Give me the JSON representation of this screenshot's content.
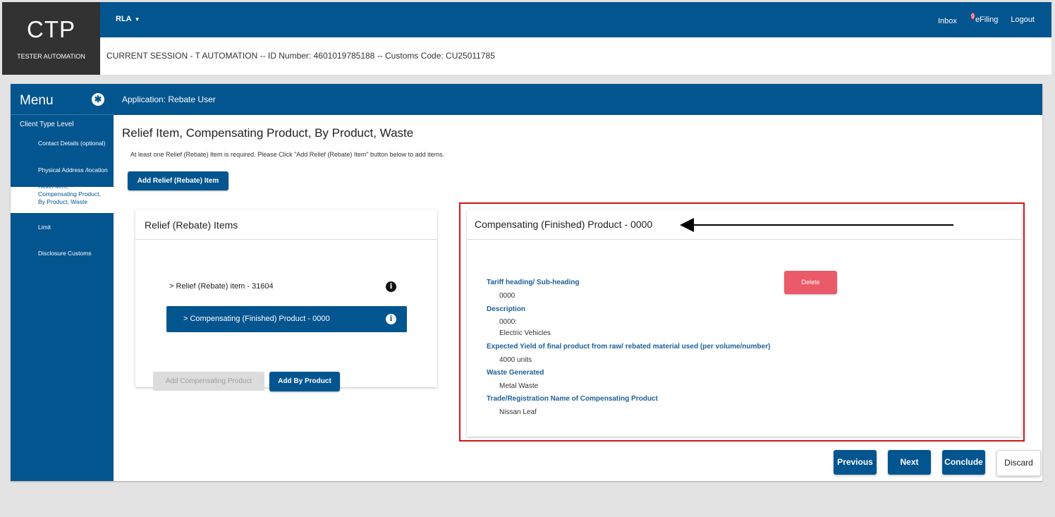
{
  "header": {
    "logo": "CTP",
    "user": "TESTER AUTOMATION",
    "app_menu": "RLA",
    "links": {
      "inbox": "Inbox",
      "inbox_count": "9",
      "efiling": "eFiling",
      "logout": "Logout"
    },
    "session": "CURRENT SESSION - T AUTOMATION -- ID Number: 4601019785188 -- Customs Code: CU25011785"
  },
  "sidebar": {
    "title": "Menu",
    "level": "Client Type Level",
    "items": [
      {
        "label": "Contact Details (optional)"
      },
      {
        "label": "Physical Address /location"
      },
      {
        "label": "Relief Item, Compensating Product, By Product, Waste"
      },
      {
        "label": "Limit"
      },
      {
        "label": "Disclosure Customs"
      }
    ]
  },
  "app_bar": {
    "title": "Application: Rebate User"
  },
  "page": {
    "title": "Relief Item, Compensating Product, By Product, Waste",
    "info": "At least one Relief (Rebate) Item is required. Please Click \"Add Relief (Rebate) Item\" button below to add items.",
    "add_relief_button": "Add Relief (Rebate) Item"
  },
  "relief_panel": {
    "title": "Relief (Rebate) Items",
    "tree": [
      {
        "label": "Relief (Rebate) item - 31604",
        "selected": false
      },
      {
        "label": "Compensating (Finished) Product - 0000",
        "selected": true
      }
    ],
    "add_compensating_button": "Add Compensating Product",
    "add_by_product_button": "Add By Product"
  },
  "compensating_panel": {
    "title": "Compensating (Finished) Product - 0000",
    "delete_button": "Delete",
    "fields": [
      {
        "label": "Tariff heading/ Sub-heading",
        "values": [
          "0000"
        ]
      },
      {
        "label": "Description",
        "values": [
          "0000:",
          "Electric Vehicles"
        ]
      },
      {
        "label": "Expected Yield of final product from raw/ rebated material used (per volume/number)",
        "values": [
          "4000 units"
        ]
      },
      {
        "label": "Waste Generated",
        "values": [
          "Metal Waste"
        ]
      },
      {
        "label": "Trade/Registration Name of Compensating Product",
        "values": [
          "Nissan Leaf"
        ]
      }
    ]
  },
  "nav": {
    "previous": "Previous",
    "next": "Next",
    "conclude": "Conclude",
    "discard": "Discard"
  },
  "colors": {
    "brand": "#03558f",
    "highlight_border": "#d0141c",
    "delete": "#ea5a69",
    "badge": "#e53a47"
  }
}
